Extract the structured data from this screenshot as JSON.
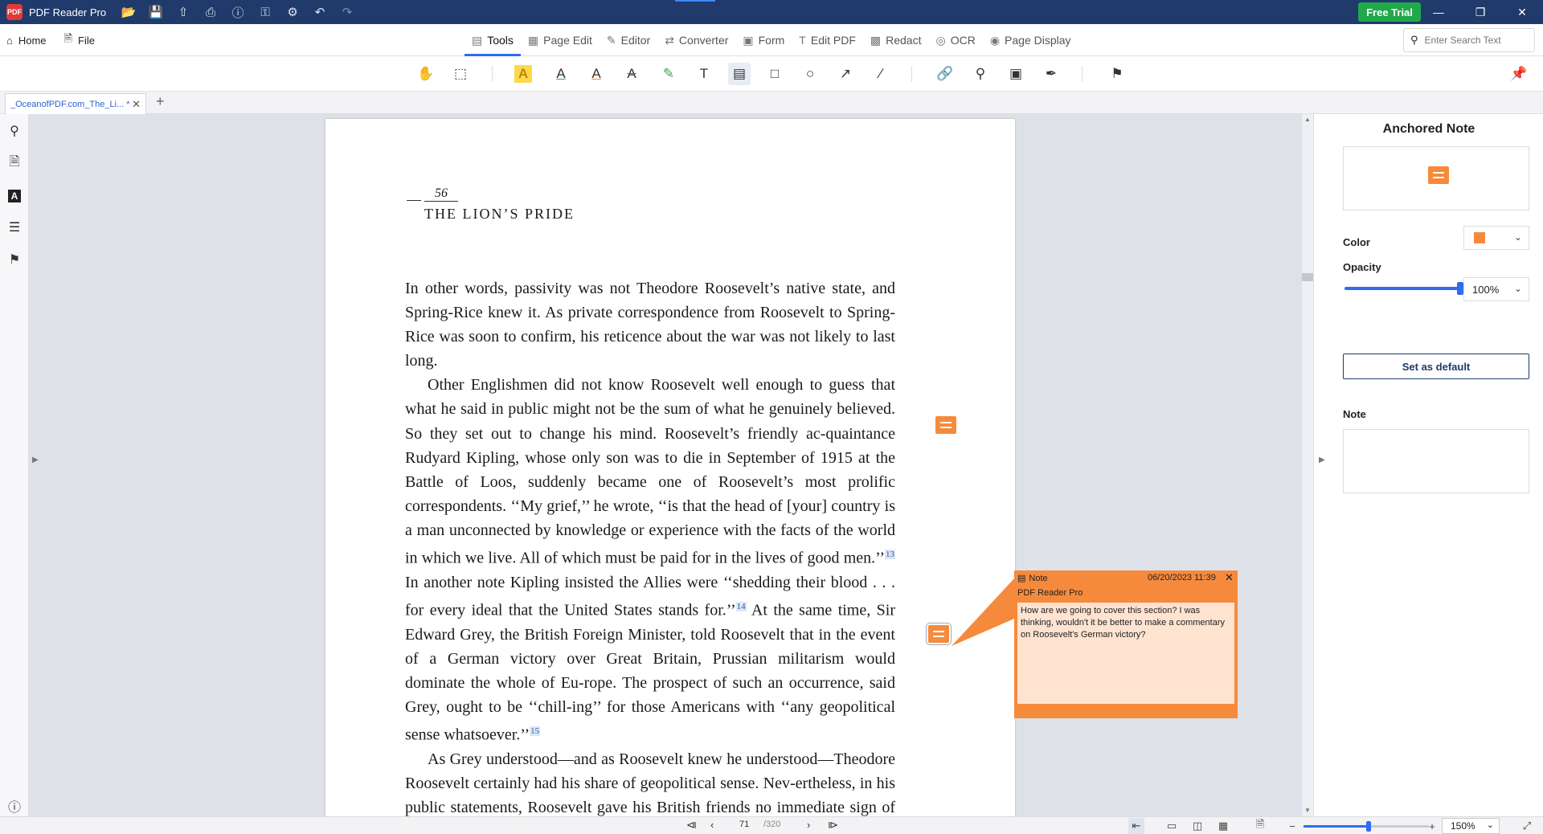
{
  "app": {
    "name": "PDF Reader Pro",
    "free_trial_label": "Free Trial"
  },
  "menubar": {
    "home_label": "Home",
    "file_label": "File",
    "tabs": [
      {
        "label": "Tools",
        "icon": "toolbox-icon",
        "active": true
      },
      {
        "label": "Page Edit",
        "icon": "grid-icon",
        "active": false
      },
      {
        "label": "Editor",
        "icon": "edit-icon",
        "active": false
      },
      {
        "label": "Converter",
        "icon": "convert-icon",
        "active": false
      },
      {
        "label": "Form",
        "icon": "form-icon",
        "active": false
      },
      {
        "label": "Edit PDF",
        "icon": "text-cursor-icon",
        "active": false
      },
      {
        "label": "Redact",
        "icon": "redact-icon",
        "active": false
      },
      {
        "label": "OCR",
        "icon": "ocr-icon",
        "active": false
      },
      {
        "label": "Page Display",
        "icon": "eye-icon",
        "active": false
      }
    ],
    "search_placeholder": "Enter Search Text"
  },
  "document_tab": {
    "title": "_OceanofPDF.com_The_Li... *"
  },
  "page": {
    "page_number": "56",
    "running_head": "THE LION’S PRIDE",
    "paragraphs": [
      {
        "indent": false,
        "segments": [
          "In other words, passivity was not Theodore Roosevelt’s native state, and Spring-Rice knew it. As private correspondence from Roosevelt to Spring-Rice was soon to confirm, his reticence about the war was not likely to last long."
        ]
      },
      {
        "indent": true,
        "segments": [
          "Other Englishmen did not know Roosevelt well enough to guess that what he said in public might not be the sum of what he genuinely believed. So they set out to change his mind. Roosevelt’s friendly ac-quaintance Rudyard Kipling, whose only son was to die in September of 1915 at the Battle of Loos, suddenly became one of Roosevelt’s most prolific correspondents. ‘‘My grief,’’ he wrote, ‘‘is that the head of [your] country is a man unconnected by knowledge or experience with the facts of the world in which we live. All of which must be paid for in the lives of good men.’’",
          "13",
          " In another note Kipling insisted the Allies were ‘‘shedding their blood . . . for every ideal that the United States stands for.’’",
          "14",
          " At the same time, Sir Edward Grey, the British Foreign Minister, told Roosevelt that in the event of a German victory over Great Britain, Prussian militarism would dominate the whole of Eu-rope. The prospect of such an occurrence, said Grey, ought to be ‘‘chill-ing’’ for those Americans with ‘‘any geopolitical sense whatsoever.’’",
          "15"
        ]
      },
      {
        "indent": true,
        "segments": [
          "As Grey understood—and as Roosevelt knew he understood—Theodore Roosevelt certainly had his share of geopolitical sense. Nev-ertheless, in his public statements, Roosevelt gave his British friends no immediate sign of sympathy with their position. In private, however,"
        ]
      }
    ]
  },
  "popup_note": {
    "label": "Note",
    "datetime": "06/20/2023 11:39",
    "author": "PDF Reader Pro",
    "content": "How are we going to cover this section? I was thinking, wouldn't it be better to make a commentary on Roosevelt's German victory?",
    "color": "#f68a3c"
  },
  "right_panel": {
    "title": "Anchored Note",
    "color_label": "Color",
    "color_value": "#f68a3c",
    "opacity_label": "Opacity",
    "opacity_value": "100%",
    "opacity_level": 1.0,
    "set_default_label": "Set as default",
    "note_label": "Note"
  },
  "bottom_bar": {
    "current_page": "71",
    "total_pages": "/320",
    "zoom_value": "150%"
  },
  "colors": {
    "titlebar": "#1f3a6b",
    "accent": "#2f6cf0",
    "note": "#f68a3c",
    "free_trial": "#21a84a"
  }
}
